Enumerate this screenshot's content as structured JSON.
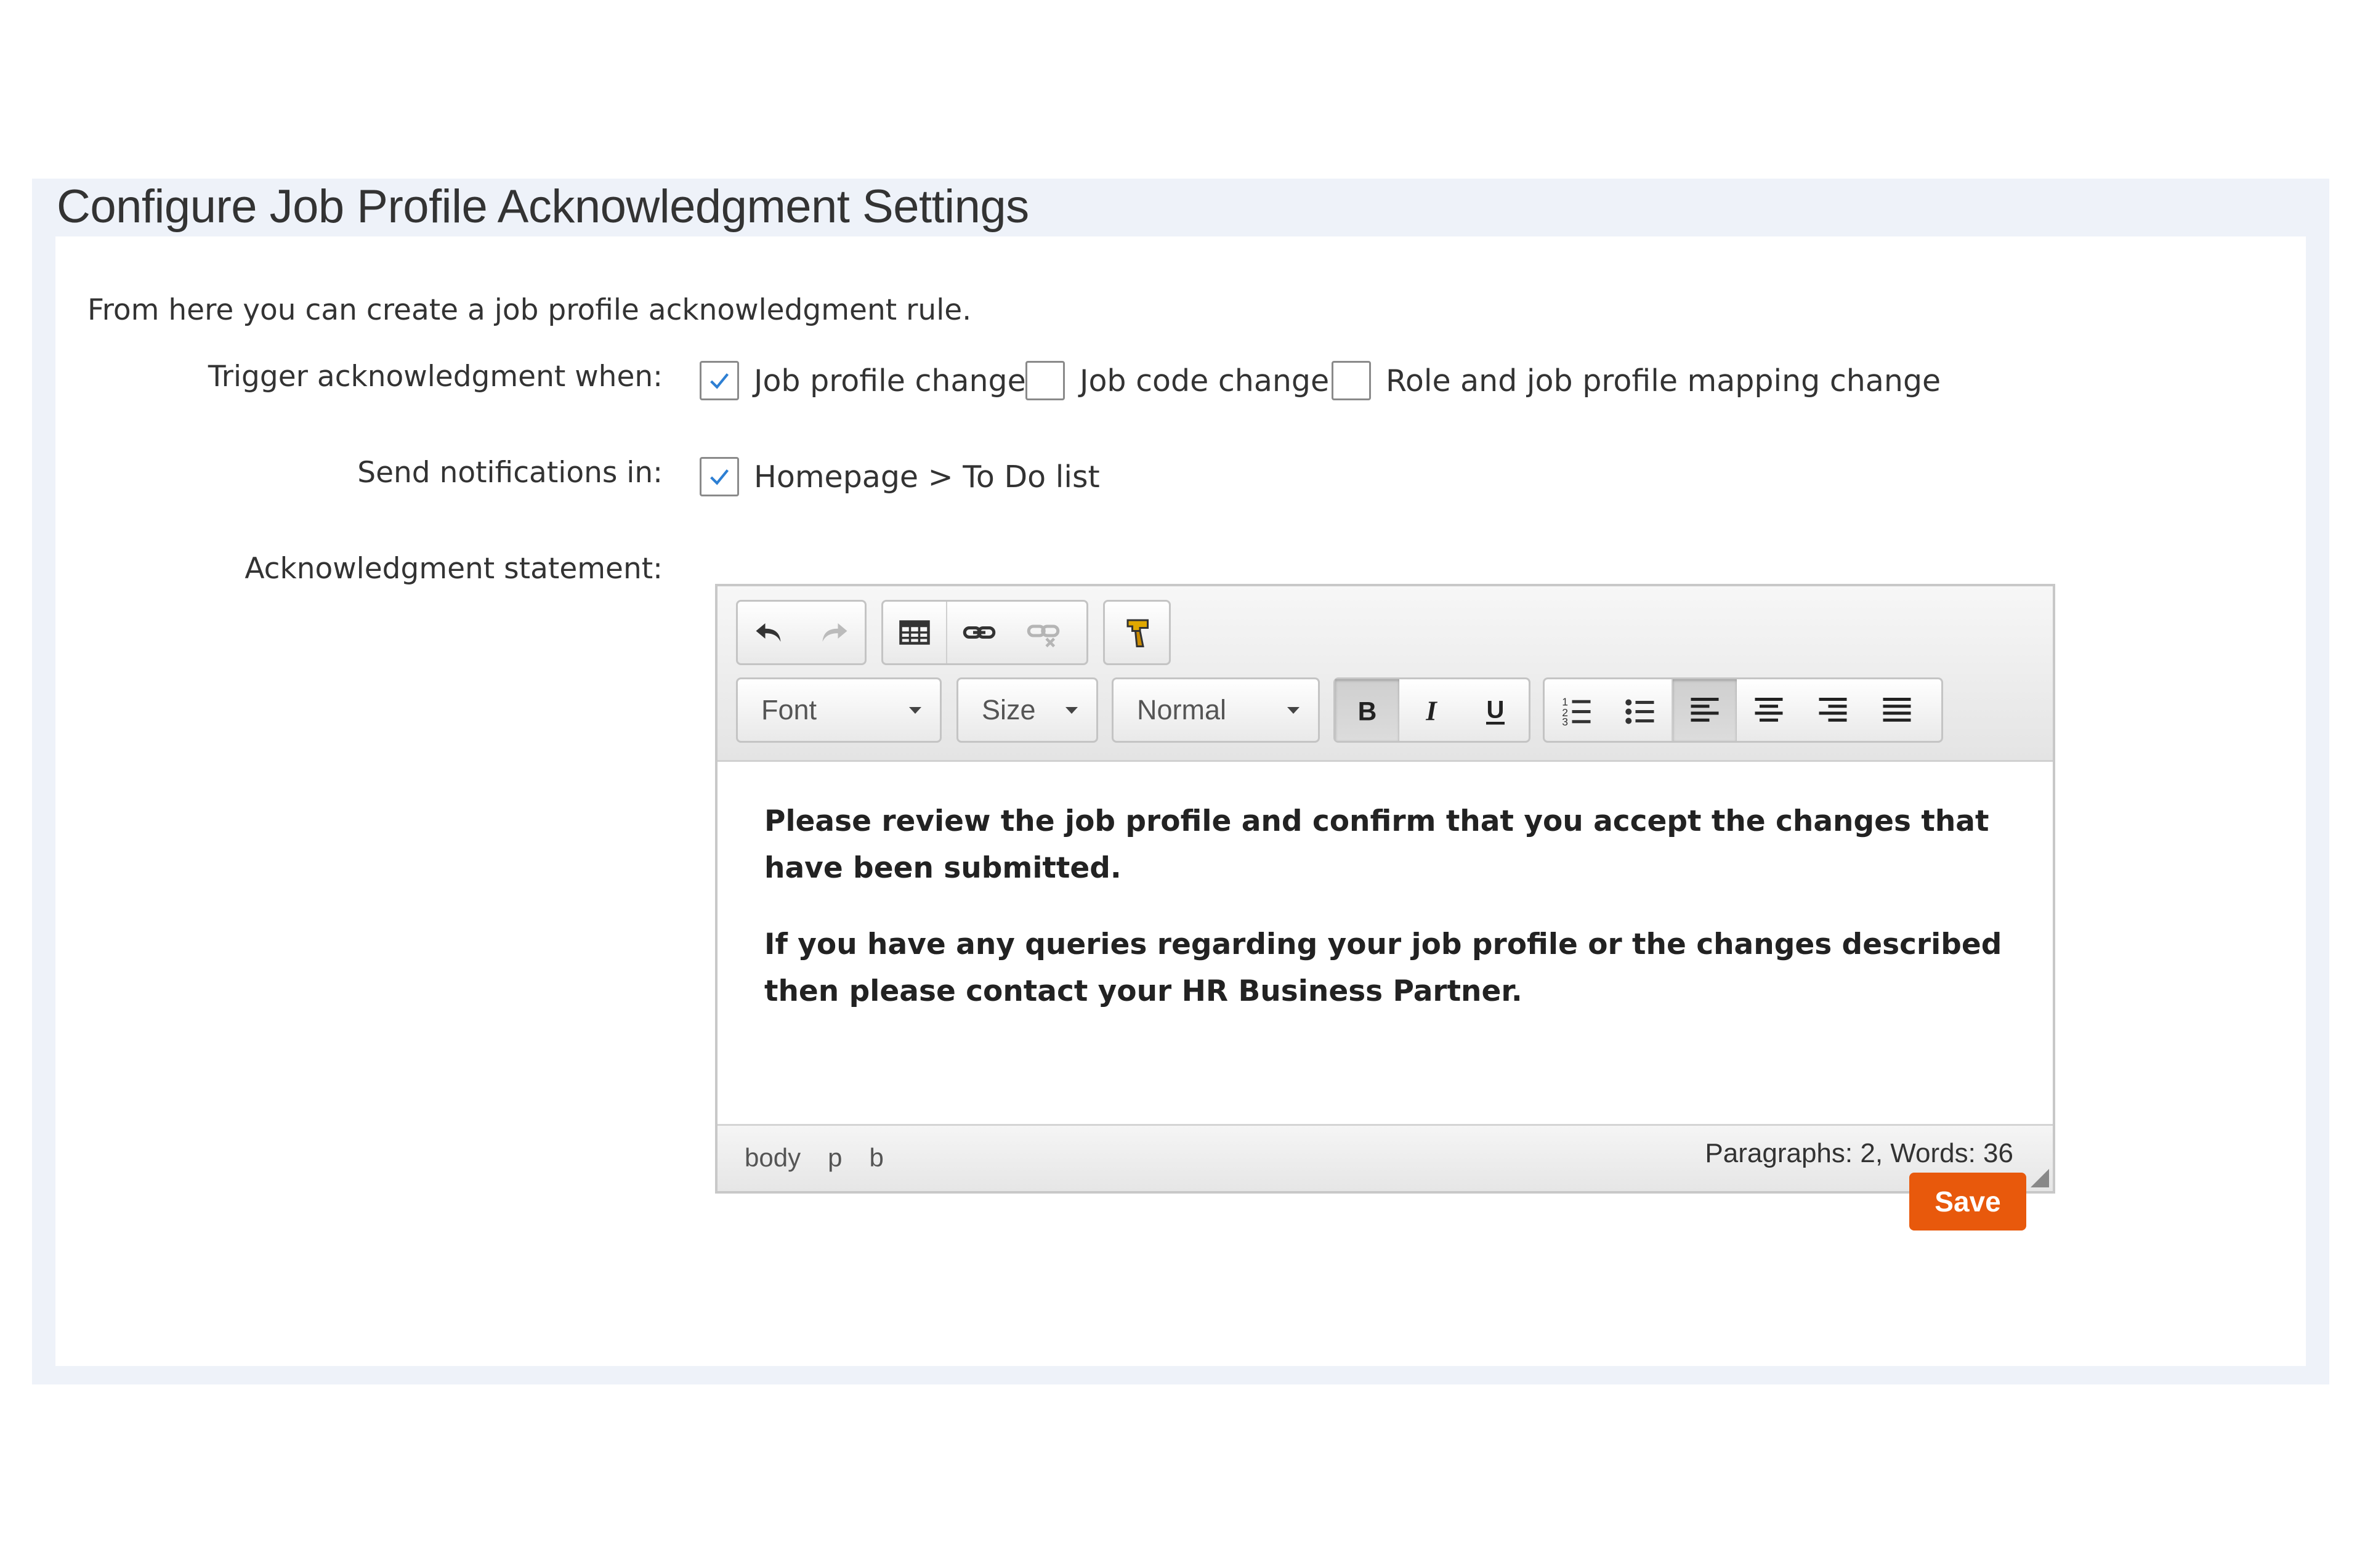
{
  "panel": {
    "title": "Configure Job Profile Acknowledgment Settings",
    "intro": "From here you can create a job profile acknowledgment rule."
  },
  "trigger": {
    "label": "Trigger acknowledgment when:",
    "options": [
      {
        "label": "Job profile change",
        "checked": true
      },
      {
        "label": "Job code change",
        "checked": false
      },
      {
        "label": "Role and job profile mapping change",
        "checked": false
      }
    ]
  },
  "notifications": {
    "label": "Send notifications in:",
    "options": [
      {
        "label": "Homepage > To Do list",
        "checked": true
      }
    ]
  },
  "statement": {
    "label": "Acknowledgment statement:",
    "toolbar": {
      "font_label": "Font",
      "size_label": "Size",
      "format_label": "Normal",
      "bold_active": true,
      "align_left_active": true
    },
    "paragraphs": [
      "Please review the job profile and confirm that you accept the changes that have been submitted.",
      "If you have any queries regarding your job profile or the changes described then please contact your HR Business Partner."
    ],
    "path": [
      "body",
      "p",
      "b"
    ],
    "counts": "Paragraphs: 2, Words: 36"
  },
  "actions": {
    "save_label": "Save",
    "save_color": "#e8590c"
  }
}
